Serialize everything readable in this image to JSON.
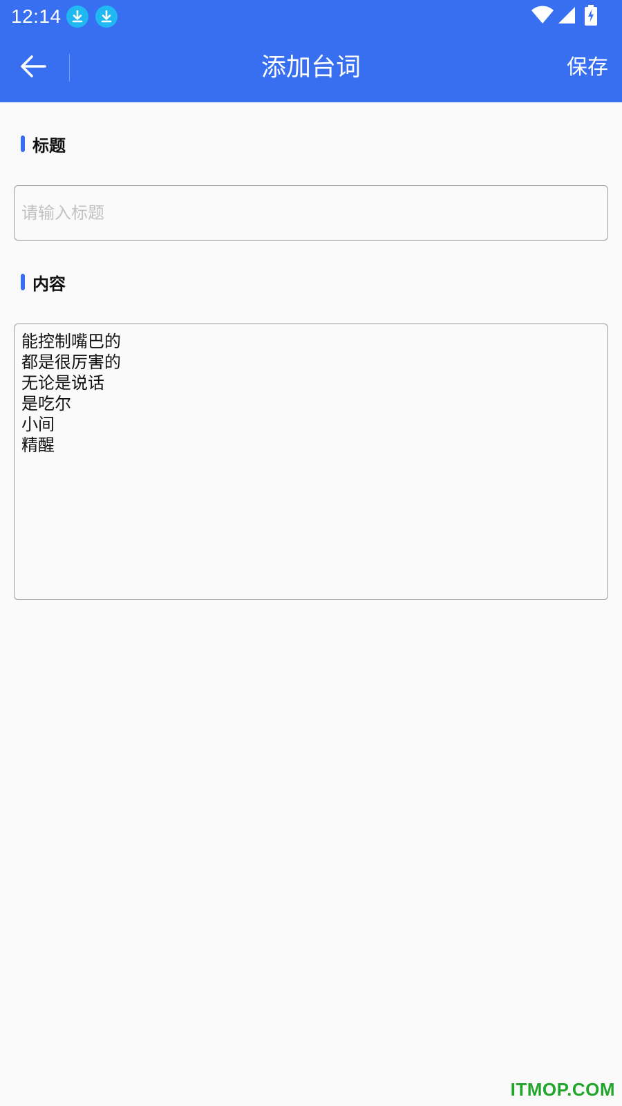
{
  "status_bar": {
    "time": "12:14",
    "notification_icons": [
      "download-icon",
      "download-icon"
    ],
    "system_icons": [
      "wifi-icon",
      "cellular-signal-icon",
      "battery-charging-icon"
    ],
    "bg_color": "#386ff0",
    "notification_color": "#1fb8f2"
  },
  "app_bar": {
    "back_icon": "arrow-left-icon",
    "title": "添加台词",
    "save_label": "保存",
    "bg_color": "#386ff0"
  },
  "form": {
    "title_section": {
      "label": "标题",
      "placeholder": "请输入标题",
      "value": ""
    },
    "content_section": {
      "label": "内容",
      "value": "能控制嘴巴的\n都是很厉害的\n无论是说话\n是吃尔\n小间\n精醒"
    },
    "accent_color": "#386ff0"
  },
  "watermark": {
    "text": "ITMOP.COM",
    "color": "#22a52b"
  }
}
